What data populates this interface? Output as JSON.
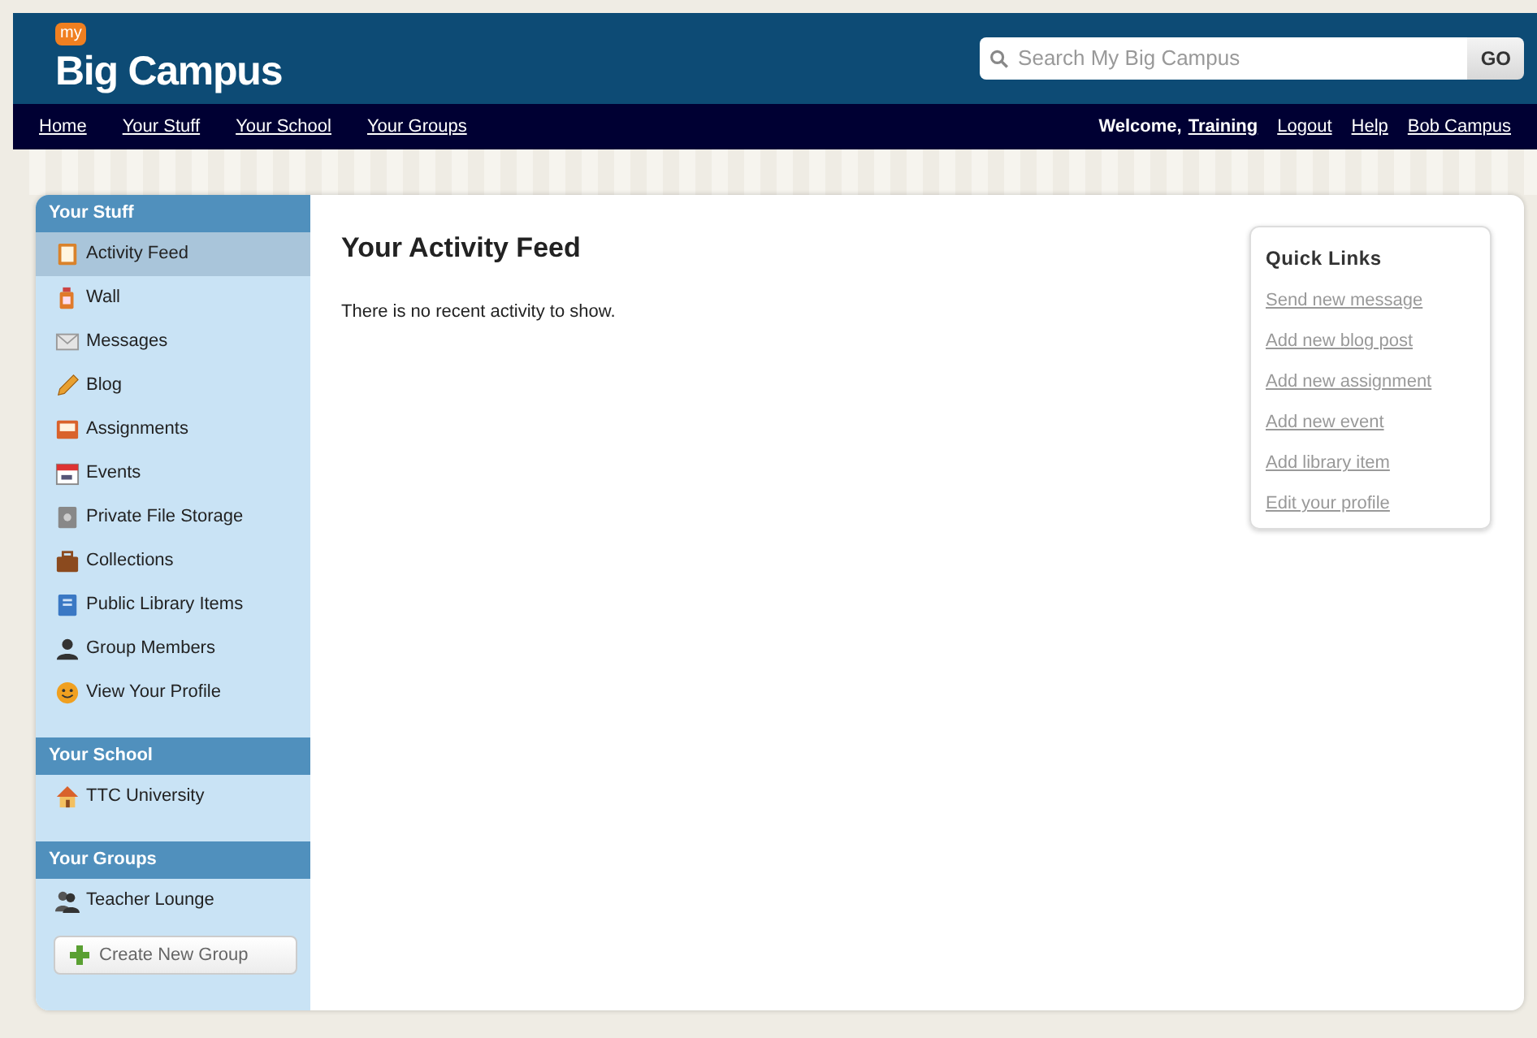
{
  "header": {
    "logo_badge": "my",
    "logo_text": "Big Campus",
    "search": {
      "placeholder": "Search My Big Campus"
    },
    "search_button": "GO"
  },
  "nav": {
    "links": [
      "Home",
      "Your Stuff",
      "Your School",
      "Your Groups"
    ],
    "welcome": "Welcome,",
    "user": "Training",
    "right_links": [
      "Logout",
      "Help",
      "Bob Campus"
    ]
  },
  "sidebar": {
    "sections": [
      {
        "title": "Your Stuff",
        "items": [
          {
            "label": "Activity Feed",
            "kind": "feed",
            "selected": true
          },
          {
            "label": "Wall",
            "kind": "wall",
            "selected": false
          },
          {
            "label": "Messages",
            "kind": "mail",
            "selected": false
          },
          {
            "label": "Blog",
            "kind": "pencil",
            "selected": false
          },
          {
            "label": "Assignments",
            "kind": "tray",
            "selected": false
          },
          {
            "label": "Events",
            "kind": "calendar",
            "selected": false
          },
          {
            "label": "Private File Storage",
            "kind": "safe",
            "selected": false
          },
          {
            "label": "Collections",
            "kind": "briefcase",
            "selected": false
          },
          {
            "label": "Public Library Items",
            "kind": "book",
            "selected": false
          },
          {
            "label": "Group Members",
            "kind": "person",
            "selected": false
          },
          {
            "label": "View Your Profile",
            "kind": "smiley",
            "selected": false
          }
        ]
      },
      {
        "title": "Your School",
        "items": [
          {
            "label": "TTC University",
            "kind": "house",
            "selected": false
          }
        ]
      },
      {
        "title": "Your Groups",
        "items": [
          {
            "label": "Teacher Lounge",
            "kind": "people",
            "selected": false
          }
        ],
        "button": "Create New Group"
      }
    ]
  },
  "main": {
    "title": "Your Activity Feed",
    "message": "There is no recent activity to show."
  },
  "quick_links": {
    "title": "Quick Links",
    "links": [
      "Send new message",
      "Add new blog post",
      "Add new assignment",
      "Add new event",
      "Add library item",
      "Edit your profile"
    ]
  }
}
